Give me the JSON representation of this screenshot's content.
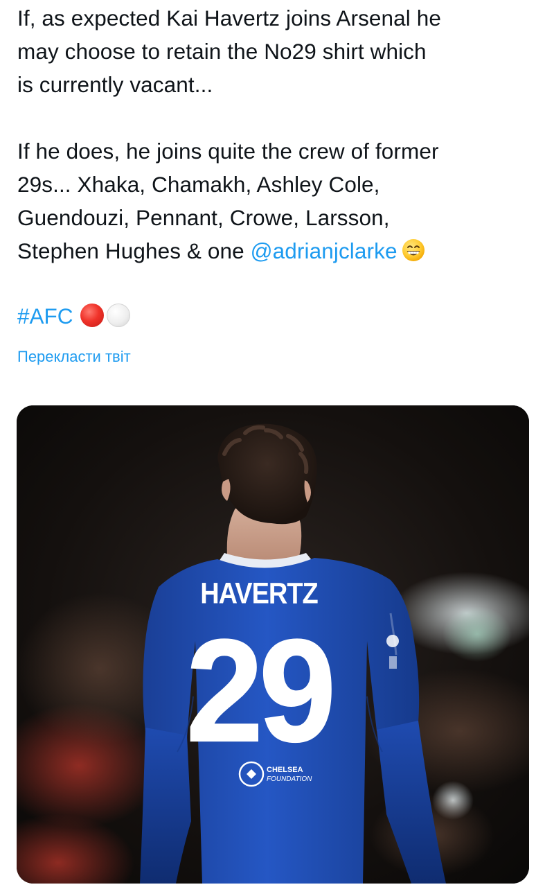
{
  "tweet": {
    "paragraph1_lines": [
      "If, as expected Kai Havertz joins Arsenal he",
      "may choose to retain the No29 shirt which",
      "is currently vacant..."
    ],
    "paragraph2_lines": [
      "If he does, he joins quite the crew of former",
      "29s... Xhaka, Chamakh, Ashley Cole,",
      "Guendouzi, Pennant, Crowe, Larsson,"
    ],
    "last_line_text": "Stephen Hughes & one ",
    "mention": "@adrianjclarke",
    "hashtag": "#AFC",
    "translate_label": "Перекласти твіт",
    "link_color": "#1d9bf0",
    "emojis": [
      "grinning-face-with-smiling-eyes",
      "red-circle",
      "white-circle"
    ]
  },
  "media": {
    "jersey_name": "HAVERTZ",
    "jersey_number": "29",
    "sponsor_line1": "CHELSEA",
    "sponsor_line2": "FOUNDATION",
    "jersey_color": "#1f4fb8",
    "background_color": "#0c0b0b"
  }
}
